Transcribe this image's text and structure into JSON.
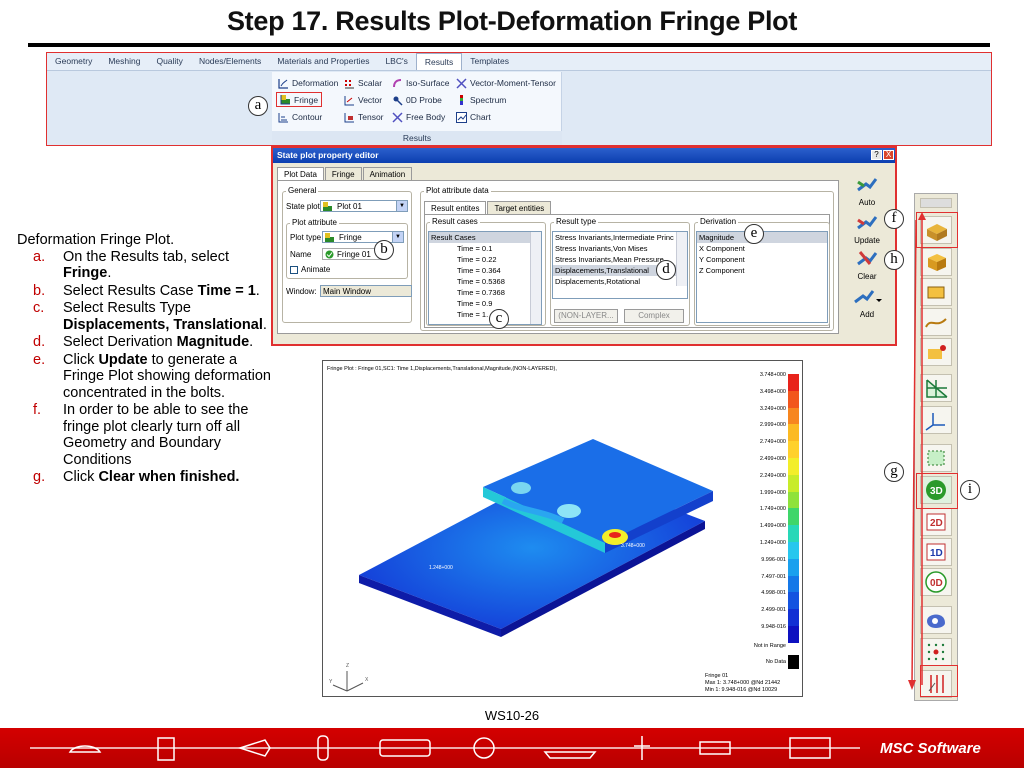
{
  "title": "Step 17. Results Plot-Deformation Fringe Plot",
  "ribbon": {
    "tabs": [
      "Geometry",
      "Meshing",
      "Quality",
      "Nodes/Elements",
      "Materials and Properties",
      "LBC's",
      "Results",
      "Templates"
    ],
    "active_tab": "Results",
    "buttons": [
      "Deformation",
      "Scalar",
      "Iso-Surface",
      "Vector-Moment-Tensor",
      "Fringe",
      "Vector",
      "0D Probe",
      "Spectrum",
      "Contour",
      "Tensor",
      "Free Body",
      "Chart"
    ],
    "group_label": "Results"
  },
  "callouts": {
    "a": "a",
    "b": "b",
    "c": "c",
    "d": "d",
    "e": "e",
    "f": "f",
    "g": "g",
    "h": "h",
    "i": "i"
  },
  "dialog": {
    "title": "State plot property editor",
    "tabs": [
      "Plot Data",
      "Fringe",
      "Animation"
    ],
    "general_label": "General",
    "state_plot_label": "State plot",
    "state_plot_value": "Plot 01",
    "plot_attribute_label": "Plot attribute",
    "plot_type_label": "Plot type",
    "plot_type_value": "Fringe",
    "name_label": "Name",
    "name_value": "Fringe 01",
    "animate_label": "Animate",
    "window_label": "Window:",
    "window_value": "Main Window",
    "plot_attribute_data_label": "Plot attribute data",
    "sub_tabs": [
      "Result entites",
      "Target entities"
    ],
    "result_cases_label": "Result cases",
    "result_cases_header": "Result Cases",
    "result_cases": [
      "Time = 0.1",
      "Time = 0.22",
      "Time = 0.364",
      "Time = 0.5368",
      "Time = 0.7368",
      "Time = 0.9",
      "Time = 1."
    ],
    "result_type_label": "Result type",
    "result_types": [
      "Stress Invariants,Intermediate Princ",
      "Stress Invariants,Von Mises",
      "Stress Invariants,Mean Pressure",
      "Displacements,Translational",
      "Displacements,Rotational"
    ],
    "derivation_label": "Derivation",
    "derivations": [
      "Magnitude",
      "X Component",
      "Y Component",
      "Z Component"
    ],
    "non_layer_btn": "(NON-LAYER...",
    "complex_btn": "Complex",
    "auto_label": "Auto",
    "update_label": "Update",
    "clear_label": "Clear",
    "add_label": "Add",
    "help_btn": "?",
    "close_btn": "X"
  },
  "instructions": {
    "heading": "Deformation Fringe Plot.",
    "steps": [
      {
        "mark": "a.",
        "pre": "On the Results tab, select ",
        "bold": "Fringe",
        "post": "."
      },
      {
        "mark": "b.",
        "pre": "Select Results Case ",
        "bold": "Time = 1",
        "post": "."
      },
      {
        "mark": "c.",
        "pre": "Select Results Type ",
        "bold": "Displacements, Translational",
        "post": "."
      },
      {
        "mark": "d.",
        "pre": "Select Derivation ",
        "bold": "Magnitude",
        "post": "."
      },
      {
        "mark": "e.",
        "pre": "Click ",
        "bold": "Update",
        "post": " to generate a Fringe Plot showing deformation concentrated in the bolts."
      },
      {
        "mark": "f.",
        "pre": "In order to be able to see the fringe plot clearly turn off all Geometry and Boundary Conditions",
        "bold": "",
        "post": ""
      },
      {
        "mark": "g.",
        "pre": "Click ",
        "bold": "Clear",
        "post": " when finished."
      }
    ]
  },
  "plot": {
    "title": "Fringe Plot : Fringe 01,SC1: Time 1,Displacements,Translational,Magnitude,(NON-LAYERED),",
    "legend_values": [
      "3.748+000",
      "3.498+000",
      "3.249+000",
      "2.999+000",
      "2.749+000",
      "2.499+000",
      "2.249+000",
      "1.999+000",
      "1.749+000",
      "1.499+000",
      "1.249+000",
      "9.996-001",
      "7.497-001",
      "4.998-001",
      "2.499-001",
      "9.948-016"
    ],
    "legend_colors": [
      "#e8231b",
      "#f2561c",
      "#f7861f",
      "#fcba22",
      "#ffd12c",
      "#f3ee2a",
      "#c8ec2a",
      "#8fe23b",
      "#3fd66a",
      "#28d8b8",
      "#27c7ee",
      "#1aa0ee",
      "#1578e8",
      "#1453e0",
      "#1230d4",
      "#0e11c0"
    ],
    "not_in_range": "Not in Range",
    "no_data": "No Data",
    "info_lines": [
      "Fringe 01",
      "Max 1: 3.748+000 @Nd 21442",
      "Min 1: 9.948-016 @Nd 10029"
    ],
    "value_label1": "1.248+000",
    "value_label2": "3.748+000",
    "axes": [
      "Z",
      "Y",
      "X"
    ]
  },
  "page_number": "WS10-26",
  "brand": "MSC Software"
}
